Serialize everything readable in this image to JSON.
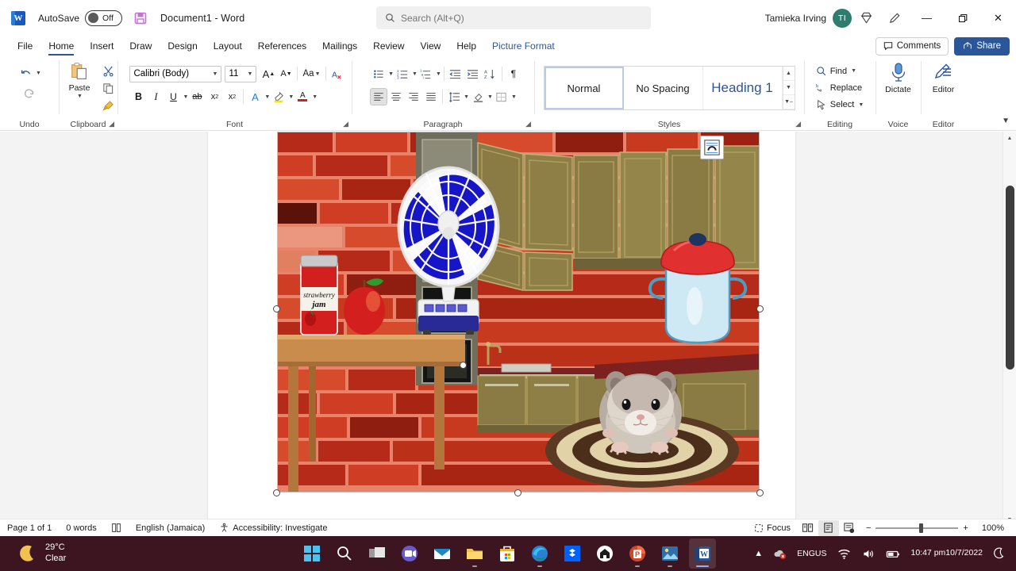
{
  "titlebar": {
    "app_icon": "word-icon",
    "autosave_label": "AutoSave",
    "autosave_state": "Off",
    "save_icon": "save-icon",
    "document_title": "Document1  -  Word",
    "user_name": "Tamieka Irving",
    "avatar_initials": "TI",
    "diamond_icon": "diamond-icon",
    "ink_icon": "pen-ink-icon",
    "minimize": "—",
    "restore": "❐",
    "close": "✕"
  },
  "search": {
    "icon": "search-icon",
    "placeholder": "Search (Alt+Q)",
    "value": ""
  },
  "tabs": [
    {
      "label": "File",
      "active": false
    },
    {
      "label": "Home",
      "active": true
    },
    {
      "label": "Insert",
      "active": false
    },
    {
      "label": "Draw",
      "active": false
    },
    {
      "label": "Design",
      "active": false
    },
    {
      "label": "Layout",
      "active": false
    },
    {
      "label": "References",
      "active": false
    },
    {
      "label": "Mailings",
      "active": false
    },
    {
      "label": "Review",
      "active": false
    },
    {
      "label": "View",
      "active": false
    },
    {
      "label": "Help",
      "active": false
    },
    {
      "label": "Picture Format",
      "active": false,
      "contextual": true
    }
  ],
  "tabbar_right": {
    "comments_label": "Comments",
    "comments_icon": "comment-icon",
    "share_label": "Share",
    "share_icon": "share-icon"
  },
  "ribbon": {
    "undo": {
      "group_label": "Undo",
      "undo_icon": "undo-arrow-icon",
      "redo_icon": "redo-arrow-icon"
    },
    "clipboard": {
      "group_label": "Clipboard",
      "paste_label": "Paste",
      "paste_icon": "clipboard-icon",
      "cut_icon": "scissors-icon",
      "copy_icon": "copy-icon",
      "format_painter_icon": "paintbrush-icon"
    },
    "font": {
      "group_label": "Font",
      "font_name": "Calibri (Body)",
      "font_size": "11",
      "grow_font_icon": "grow-font-icon",
      "shrink_font_icon": "shrink-font-icon",
      "change_case_label": "Aa",
      "clear_formatting_icon": "clear-formatting-icon",
      "bold_label": "B",
      "italic_label": "I",
      "underline_label": "U",
      "strikethrough_label": "ab",
      "subscript_label": "x",
      "superscript_label": "x",
      "text_effects_label": "A",
      "highlight_label": "A",
      "font_color_label": "A"
    },
    "paragraph": {
      "group_label": "Paragraph",
      "bullets_icon": "bullet-list-icon",
      "numbering_icon": "numbered-list-icon",
      "multilevel_icon": "multilevel-list-icon",
      "decrease_indent_icon": "decrease-indent-icon",
      "increase_indent_icon": "increase-indent-icon",
      "sort_icon": "sort-az-icon",
      "show_marks_label": "¶",
      "align_left_icon": "align-left-icon",
      "align_center_icon": "align-center-icon",
      "align_right_icon": "align-right-icon",
      "justify_icon": "justify-icon",
      "line_spacing_icon": "line-spacing-icon",
      "shading_icon": "shading-icon",
      "borders_icon": "borders-icon"
    },
    "styles": {
      "group_label": "Styles",
      "items": [
        {
          "label": "Normal",
          "selected": true
        },
        {
          "label": "No Spacing",
          "selected": false
        },
        {
          "label": "Heading 1",
          "selected": false
        }
      ],
      "scroll_up_icon": "chevron-up-icon",
      "scroll_down_icon": "chevron-down-icon",
      "more_icon": "styles-more-icon"
    },
    "editing": {
      "group_label": "Editing",
      "find_label": "Find",
      "find_icon": "search-icon",
      "replace_label": "Replace",
      "replace_icon": "replace-icon",
      "select_label": "Select",
      "select_icon": "cursor-arrow-icon"
    },
    "voice": {
      "group_label": "Voice",
      "dictate_label": "Dictate",
      "dictate_icon": "microphone-icon"
    },
    "editor": {
      "group_label": "Editor",
      "editor_label": "Editor",
      "editor_icon": "editor-pen-icon"
    },
    "collapse_icon": "chevron-down-icon"
  },
  "document": {
    "image_alt": "kitchen-clipart-with-hamster",
    "layout_options_icon": "layout-options-icon",
    "selected": true
  },
  "statusbar": {
    "page_label": "Page 1 of 1",
    "word_count": "0 words",
    "proofing_icon": "proofing-icon",
    "language": "English (Jamaica)",
    "accessibility_icon": "accessibility-icon",
    "accessibility_label": "Accessibility: Investigate",
    "focus_label": "Focus",
    "focus_icon": "focus-icon",
    "read_mode_icon": "read-mode-icon",
    "print_layout_icon": "print-layout-icon",
    "web_layout_icon": "web-layout-icon",
    "zoom_out_label": "−",
    "zoom_in_label": "+",
    "zoom_level": "100%"
  },
  "taskbar": {
    "weather_temp": "29°C",
    "weather_cond": "Clear",
    "weather_icon": "moon-icon",
    "apps": [
      {
        "name": "start-button",
        "icon": "windows-logo-icon"
      },
      {
        "name": "search-taskbar",
        "icon": "search-icon"
      },
      {
        "name": "task-view",
        "icon": "task-view-icon"
      },
      {
        "name": "teams",
        "icon": "teams-icon"
      },
      {
        "name": "mail",
        "icon": "mail-icon"
      },
      {
        "name": "file-explorer",
        "icon": "folder-icon"
      },
      {
        "name": "microsoft-store",
        "icon": "store-icon"
      },
      {
        "name": "edge",
        "icon": "edge-icon"
      },
      {
        "name": "dropbox",
        "icon": "dropbox-icon"
      },
      {
        "name": "grammarly",
        "icon": "circle-house-icon"
      },
      {
        "name": "powerpoint",
        "icon": "powerpoint-icon"
      },
      {
        "name": "photos",
        "icon": "photos-icon"
      },
      {
        "name": "word",
        "icon": "word-icon"
      }
    ],
    "tray": {
      "chevron_icon": "chevron-up-icon",
      "onedrive_icon": "onedrive-paused-icon",
      "language_line1": "ENG",
      "language_line2": "US",
      "wifi_icon": "wifi-icon",
      "volume_icon": "volume-icon",
      "battery_icon": "battery-icon",
      "time": "10:47 pm",
      "date": "10/7/2022",
      "notification_icon": "moon-icon"
    }
  },
  "colors": {
    "accent": "#2b579a",
    "contextual_tab": "#2b579a",
    "avatar": "#2e7d6f",
    "taskbar": "#3d1520",
    "heading1": "#2f5496"
  }
}
